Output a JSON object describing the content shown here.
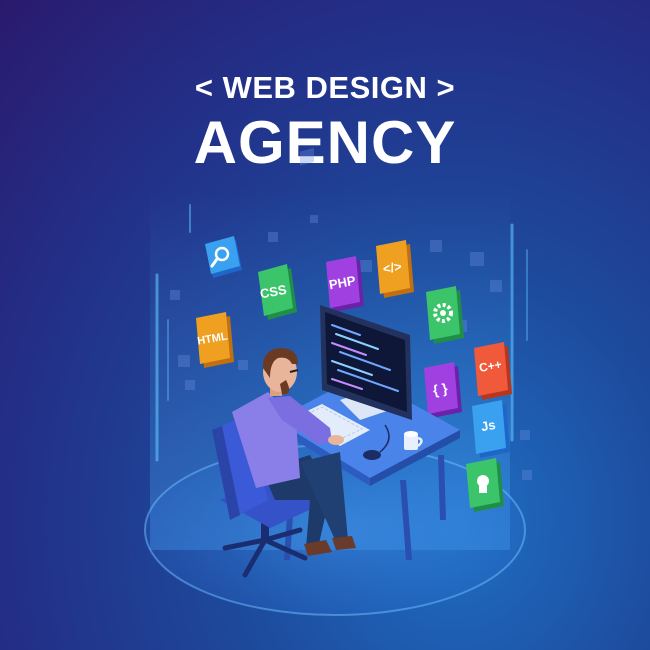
{
  "header": {
    "line1": "< WEB DESIGN >",
    "line2": "AGENCY"
  },
  "tiles": {
    "html": "HTML",
    "css": "CSS",
    "php": "PHP",
    "cpp": "C++",
    "js": "Js"
  },
  "icons": [
    "search-icon",
    "code-tag-icon",
    "gear-icon",
    "curly-braces-icon",
    "lightbulb-icon"
  ],
  "colors": {
    "bg_dark": "#2a1a6e",
    "bg_light": "#1f6fc4",
    "tile_blue": "#3aa0f0",
    "tile_green": "#3cc46a",
    "tile_purple": "#a040e0",
    "tile_orange": "#f0a020",
    "tile_red": "#f05a3a",
    "shirt": "#8a7ee8",
    "desk": "#3f74e0"
  }
}
